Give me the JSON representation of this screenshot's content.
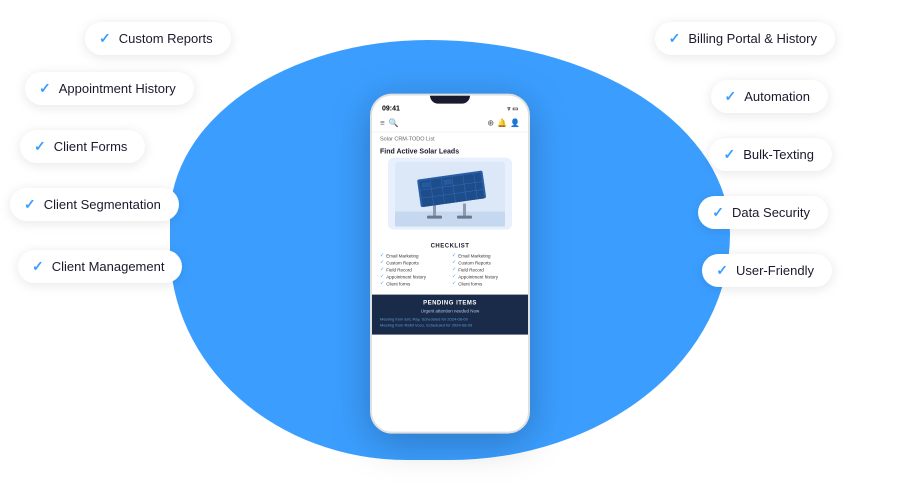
{
  "background": {
    "blob_color": "#3b9eff"
  },
  "left_pills": [
    {
      "id": "custom-reports",
      "label": "Custom Reports",
      "check": "✓"
    },
    {
      "id": "appointment-history",
      "label": "Appointment History",
      "check": "✓"
    },
    {
      "id": "client-forms",
      "label": "Client Forms",
      "check": "✓"
    },
    {
      "id": "client-segmentation",
      "label": "Client Segmentation",
      "check": "✓"
    },
    {
      "id": "client-management",
      "label": "Client Management",
      "check": "✓"
    }
  ],
  "right_pills": [
    {
      "id": "billing",
      "label": "Billing Portal & History",
      "check": "✓"
    },
    {
      "id": "automation",
      "label": "Automation",
      "check": "✓"
    },
    {
      "id": "bulk-texting",
      "label": "Bulk-Texting",
      "check": "✓"
    },
    {
      "id": "data-security",
      "label": "Data Security",
      "check": "✓"
    },
    {
      "id": "user-friendly",
      "label": "User-Friendly",
      "check": "✓"
    }
  ],
  "phone": {
    "status_time": "09:41",
    "crm_label": "Solar CRM-TODO List",
    "section_title": "Find Active Solar Leads",
    "checklist_title": "CHECKLIST",
    "checklist_items": [
      "Email Marketing",
      "Email Marketing",
      "Custom Reports",
      "Custom Reports",
      "Field Record",
      "Field Record",
      "Appointment history",
      "Appointment history",
      "Client forms",
      "Client forms"
    ],
    "pending_title": "PENDING ITEMS",
    "pending_subtitle": "Urgent attention needed Now",
    "pending_items": [
      "Meeting from Eric Ray, Scheduled for 2024-08-09",
      "Meeting from Rafid Voco, Scheduled for 2024-08-09"
    ]
  }
}
